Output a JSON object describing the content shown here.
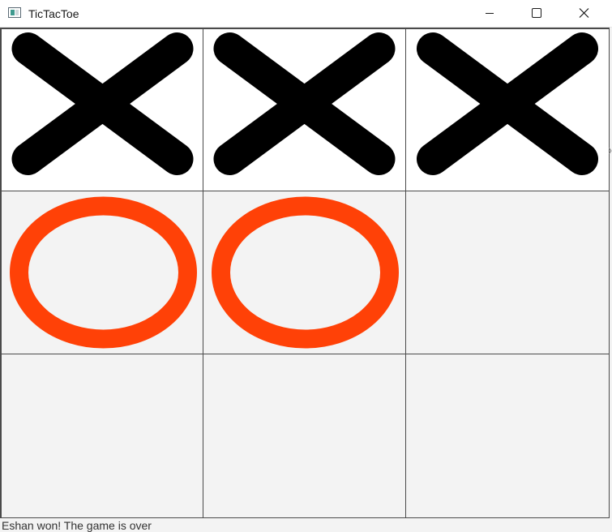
{
  "window": {
    "title": "TicTacToe",
    "icon": "app-window-icon",
    "controls": {
      "minimize_icon": "minimize-icon",
      "maximize_icon": "maximize-icon",
      "close_icon": "close-icon"
    }
  },
  "board": {
    "rows": 3,
    "cols": 3,
    "cells": [
      [
        "X",
        "X",
        "X"
      ],
      [
        "O",
        "O",
        ""
      ],
      [
        "",
        "",
        ""
      ]
    ],
    "colors": {
      "x_mark": "#000000",
      "o_mark": "#ff4107",
      "grid_line": "#4a4a4a",
      "top_row_bg": "#ffffff",
      "cell_bg": "#f3f3f3"
    }
  },
  "status": {
    "message": "Eshan won! The game is over"
  }
}
